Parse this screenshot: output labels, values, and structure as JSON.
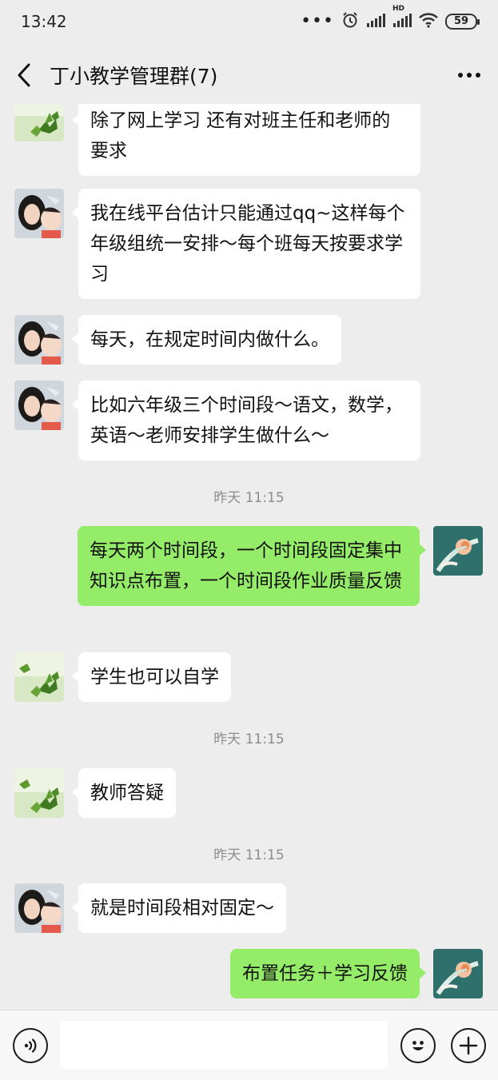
{
  "status_bar": {
    "time": "13:42",
    "dots": "•••",
    "hd_label": "HD",
    "battery": "59"
  },
  "nav": {
    "title": "丁小教学管理群(7)",
    "back_icon": "chevron-left-icon",
    "more_icon": "more-dots-icon"
  },
  "messages": [
    {
      "side": "left",
      "avatar": "leaves",
      "text": "除了网上学习 还有对班主任和老师的要求"
    },
    {
      "side": "left",
      "avatar": "mother-child",
      "text": "我在线平台估计只能通过qq~这样每个年级组统一安排～每个班每天按要求学习"
    },
    {
      "side": "left",
      "avatar": "mother-child",
      "text": "每天，在规定时间内做什么。"
    },
    {
      "side": "left",
      "avatar": "mother-child",
      "text": "比如六年级三个时间段～语文，数学，英语～老师安排学生做什么～"
    },
    {
      "type": "time",
      "text": "昨天 11:15"
    },
    {
      "side": "right",
      "avatar": "teal-flower",
      "text": "每天两个时间段，一个时间段固定集中知识点布置，一个时间段作业质量反馈"
    },
    {
      "side": "left",
      "avatar": "leaves",
      "text": "学生也可以自学"
    },
    {
      "type": "time",
      "text": "昨天 11:15"
    },
    {
      "side": "left",
      "avatar": "leaves",
      "text": "教师答疑"
    },
    {
      "type": "time",
      "text": "昨天 11:15"
    },
    {
      "side": "left",
      "avatar": "mother-child",
      "text": "就是时间段相对固定～"
    },
    {
      "side": "right",
      "avatar": "teal-flower",
      "text": "布置任务＋学习反馈"
    }
  ],
  "input_bar": {
    "voice_icon": "voice-icon",
    "emoji_icon": "emoji-icon",
    "plus_icon": "plus-icon",
    "value": ""
  },
  "colors": {
    "background": "#ededed",
    "own_bubble": "#95ec69",
    "other_bubble": "#ffffff",
    "timestamp": "#8c8c8c"
  }
}
